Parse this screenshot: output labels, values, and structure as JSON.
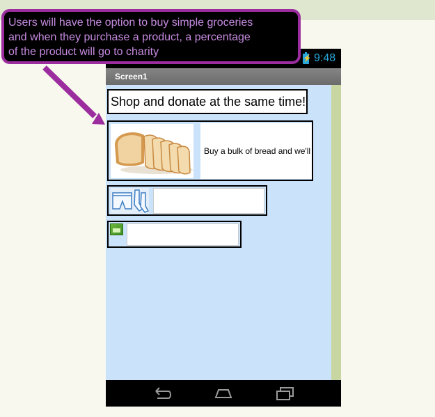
{
  "app": {
    "status_bar": {
      "time": "9:48"
    },
    "title_bar": {
      "title": "Screen1"
    },
    "screen": {
      "heading": "Shop and donate at the same time!",
      "products": [
        {
          "image": "bread-loaf-image",
          "label": "Buy a bulk of bread and we'll"
        },
        {
          "image": "underwear-socks-image",
          "label": ""
        },
        {
          "image": "placeholder-image-icon",
          "label": ""
        }
      ]
    },
    "nav_bar": {
      "icons": [
        "back-icon",
        "home-icon",
        "recent-apps-icon"
      ]
    }
  },
  "annotation": {
    "lines": [
      "Users will have the option to buy simple groceries",
      "and when they purchase a product, a percentage",
      "of the product will go to charity"
    ],
    "colors": {
      "border": "#9b2d9e",
      "text": "#c68ae0",
      "arrow": "#9b2d9e"
    }
  },
  "colors": {
    "screen_background": "#cbe3fa",
    "scrollbar": "#c8d6a2",
    "status_accent": "#28a8dc"
  }
}
